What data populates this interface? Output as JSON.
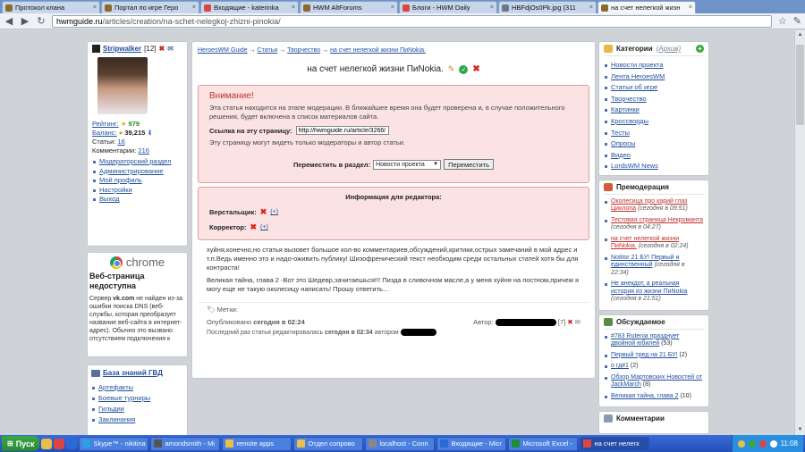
{
  "browser": {
    "tabs": [
      {
        "label": "Протокол клана",
        "color": "#8a6a30"
      },
      {
        "label": "Портал по игре Геро",
        "color": "#8a6a30"
      },
      {
        "label": "Входящие - katerinka",
        "color": "#d44"
      },
      {
        "label": "HWM AltForums",
        "color": "#8a6a30"
      },
      {
        "label": "Блоги - HWM Daily",
        "color": "#d44"
      },
      {
        "label": "HBFdjOs0Pk.jpg (311",
        "color": "#6a7a8a"
      },
      {
        "label": "на счет нелегкой жизн",
        "color": "#8a6a30",
        "active": true
      }
    ],
    "url_host": "hwmguide.ru",
    "url_path": "/articles/creation/na-schet-nelegkoj-zhizni-pinokia/"
  },
  "user": {
    "name": "Stripwalker",
    "level": "[12]",
    "rating_label": "Рейтинг:",
    "rating_value": "979",
    "balance_label": "Баланс:",
    "balance_value": "39,215",
    "articles_label": "Статьи:",
    "articles_value": "16",
    "comments_label": "Комментарии:",
    "comments_value": "216",
    "links": [
      "Модераторский раздел",
      "Администрирование",
      "Мой профиль",
      "Настройки",
      "Выход"
    ]
  },
  "chrome_error": {
    "logo": "chrome",
    "title": "Веб-страница недоступна",
    "text_before": "Сервер ",
    "text_host": "vk.com",
    "text_after": " не найден из-за ошибки поиска DNS (веб-службы, которая преобразует название веб-сайта в интернет-адрес). Обычно это вызвано отсутствием подключения к"
  },
  "knowledge": {
    "title": "База знаний ГВД",
    "items": [
      "Артефакты",
      "Боевые турниры",
      "Гильдии",
      "Заклинания"
    ]
  },
  "article": {
    "crumb_home": "HeroesWM Guide",
    "crumb_sep": "→",
    "crumb_articles": "Статьи",
    "crumb_creation": "Творчество",
    "crumb_current": "на счет нелегкой жизни ПиNokia.",
    "title": "на счет нелегкой жизни ПиNokia.",
    "warning_title": "Внимание!",
    "warning_text": "Эта статья находится на этапе модерации. В ближайшее время она будет проверена и, в случае положительного решения, будет включена в список материалов сайта.",
    "link_label": "Ссылка на эту страницу:",
    "link_value": "http://hwmguide.ru/article/3266/",
    "visible_text": "Эту страницу могут видеть только модераторы и автор статьи.",
    "move_label": "Переместить в раздел:",
    "move_selected": "Новости проекта",
    "move_button": "Переместить",
    "editor_title": "Информация для редактора:",
    "proofreader_label": "Верстальщик:",
    "corrector_label": "Корректор:",
    "add_label": "(+)",
    "paragraph1": "хуйня,конечно,но статья вызовет большое кол-во комментариев,обсуждений,критики,острых замечаний в мой адрес и т.п.Ведь именно это и надо-оживить публику! Шизофренический текст необходим среди остальных статей хотя бы для контраста!",
    "paragraph2": "Великая тайна, глава 2 -Вот это Шедевр,зачитаешься!!! Пизда в сливочном масле,а у меня хуйня на постном,причем я могу еще не такую околесицу написать! Прошу ответить...",
    "tags_label": "Метки:",
    "published": "Опубликовано",
    "published_when": "сегодня в 02:24",
    "author_label": "Автор:",
    "author_level": "[7]",
    "last_edit_prefix": "Последний раз статья редактировалась",
    "last_edit_when": "сегодня в 02:34",
    "last_edit_by": "автором"
  },
  "sidebar": {
    "categories_title": "Категории",
    "categories_archive": "(Архив)",
    "categories": [
      "Новости проекта",
      "Лента HeroesWM",
      "Статьи об игре",
      "Творчество",
      "Картинки",
      "Кроссворды",
      "Тесты",
      "Опросы",
      "Видео",
      "LordsWM News"
    ],
    "premod_title": "Премодерация",
    "premod": [
      {
        "title": "Околесица про карий глаз Циклопа",
        "date": "(сегодня в 09:51)",
        "red": true
      },
      {
        "title": "Тестовая страница Некроманта",
        "date": "(сегодня в 04:27)",
        "red": true
      },
      {
        "title": "на счет нелегкой жизни ПиNokia.",
        "date": "(сегодня в 02:24)",
        "red": true
      },
      {
        "title": "Notitor 21 БУ! Первый и единственный",
        "date": "(сегодня в 22:34)",
        "red": false
      },
      {
        "title": "Не анекдот, а реальная история из жизни ПиNokia",
        "date": "(сегодня в 21:51)",
        "red": false
      }
    ],
    "discussed_title": "Обсуждаемое",
    "discussed": [
      {
        "title": "#783 Rutenia празднует двойной юбилей",
        "count": "(53)"
      },
      {
        "title": "Первый тред на 21 БУ!",
        "count": "(2)"
      },
      {
        "title": "о гд#1",
        "count": "(2)"
      },
      {
        "title": "Обзор Мартовских Новостей от JackMarch",
        "count": "(8)"
      },
      {
        "title": "Великая тайна, глава 2",
        "count": "(10)"
      }
    ],
    "comments_title": "Комментарии"
  },
  "taskbar": {
    "start": "Пуск",
    "items": [
      {
        "label": "Skype™ - nikitina",
        "color": "#2aa0e8"
      },
      {
        "label": "amondsmith - Mi",
        "color": "#555"
      },
      {
        "label": "remote apps",
        "color": "#e8c04a"
      },
      {
        "label": "Отдел сопрово",
        "color": "#e8c04a"
      },
      {
        "label": "localhost - Conn",
        "color": "#888"
      },
      {
        "label": "Входящие - Micr",
        "color": "#2a6ad8"
      },
      {
        "label": "Microsoft Excel -",
        "color": "#1f8a3a"
      },
      {
        "label": "на счет нелегк",
        "color": "#d44",
        "active": true
      }
    ],
    "clock": "11:08"
  }
}
